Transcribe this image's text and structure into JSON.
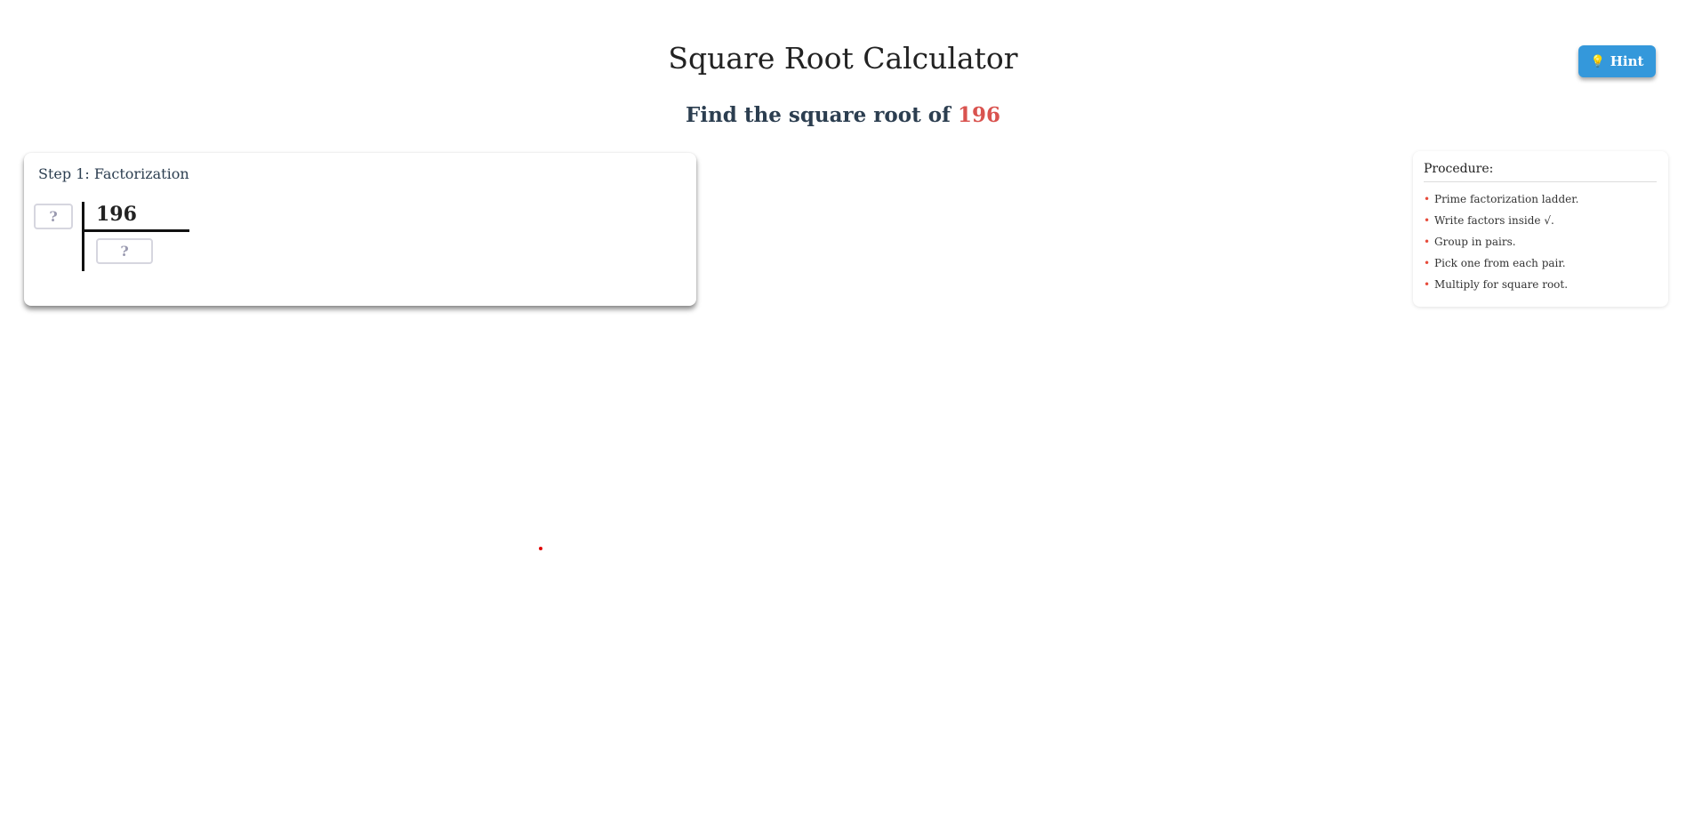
{
  "header": {
    "title": "Square Root Calculator",
    "hint_label": "Hint",
    "hint_icon": "lightbulb-icon"
  },
  "question": {
    "prefix": "Find the square root of",
    "number": "196",
    "number_color": "#d9534f"
  },
  "step": {
    "title": "Step 1: Factorization",
    "dividend": "196",
    "divisor_placeholder": "?",
    "quotient_placeholder": "?"
  },
  "procedure": {
    "title": "Procedure:",
    "items": [
      "Prime factorization ladder.",
      "Write factors inside √.",
      "Group in pairs.",
      "Pick one from each pair.",
      "Multiply for square root."
    ]
  },
  "colors": {
    "hint_button": "#3498db",
    "bullet": "#e74c3c",
    "heading": "#2c3e50"
  }
}
